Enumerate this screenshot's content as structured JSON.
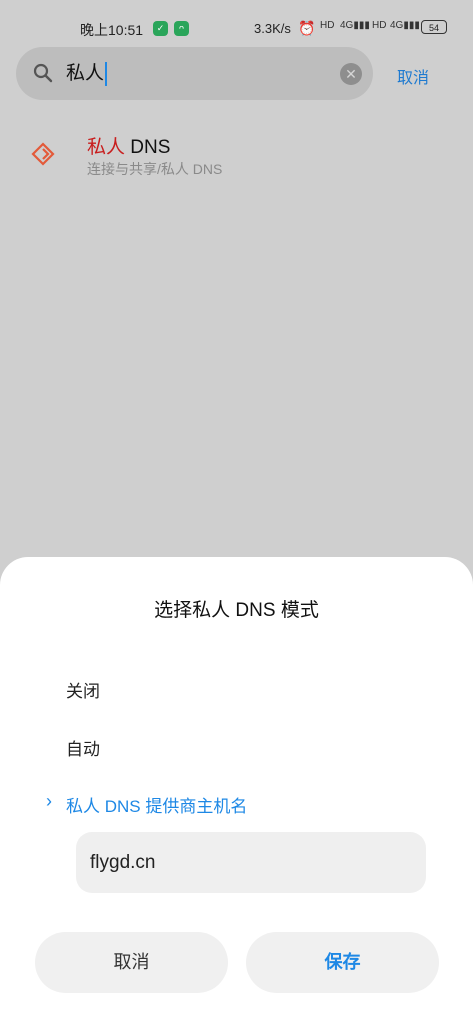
{
  "status_bar": {
    "time": "晚上10:51",
    "network_speed": "3.3K/s",
    "battery": "54",
    "icons": [
      "shield-app-icon",
      "app-icon",
      "alarm-off-icon",
      "hd-icon",
      "signal-4g-icon",
      "hd-icon",
      "signal-4g-icon",
      "battery-icon"
    ]
  },
  "search": {
    "query": "私人",
    "cancel_label": "取消"
  },
  "result": {
    "title_highlight": "私人",
    "title_rest": " DNS",
    "path": "连接与共享/私人 DNS"
  },
  "dialog": {
    "title": "选择私人 DNS 模式",
    "options": [
      "关闭",
      "自动",
      "私人 DNS 提供商主机名"
    ],
    "selected_index": 2,
    "hostname_value": "flygd.cn",
    "cancel_label": "取消",
    "save_label": "保存"
  },
  "colors": {
    "accent": "#1e88e5",
    "highlight": "#c81e1e",
    "scrim": "#cfcfcf"
  }
}
